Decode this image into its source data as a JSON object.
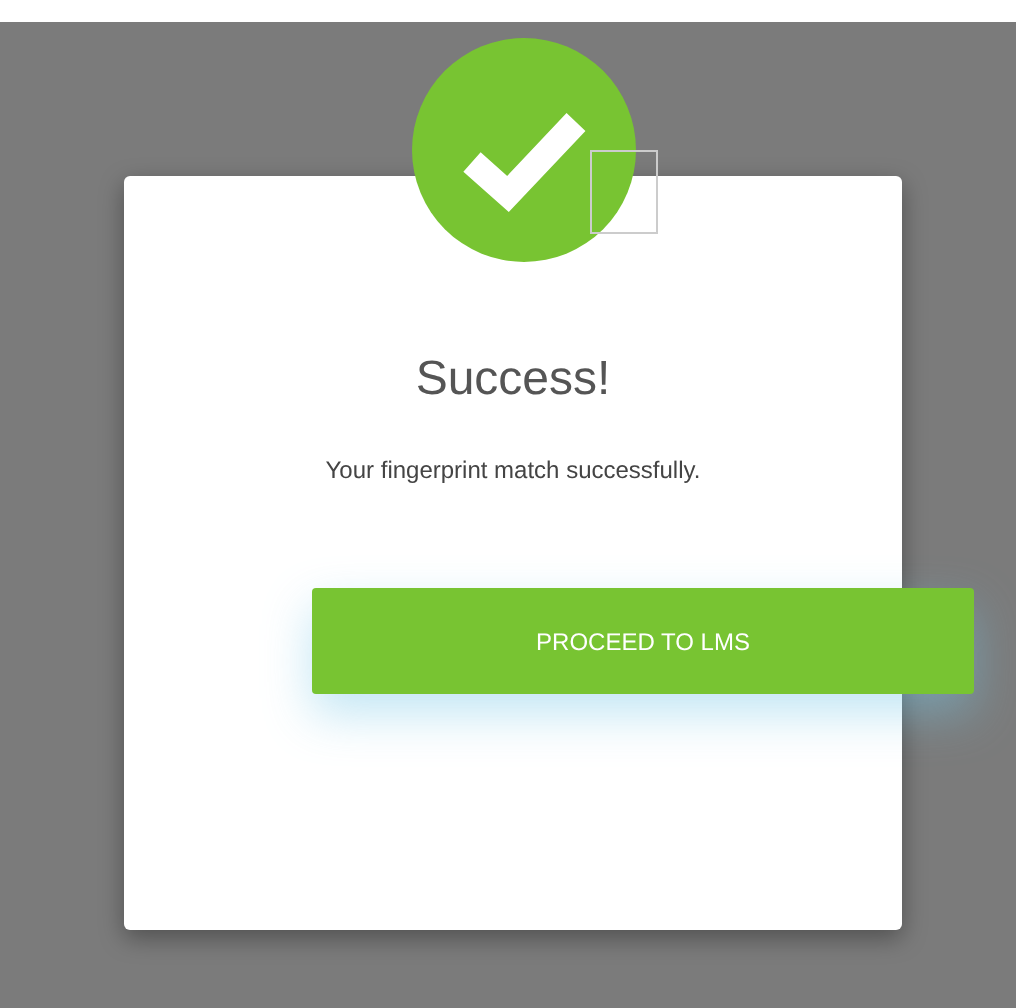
{
  "dialog": {
    "title": "Success!",
    "message": "Your fingerprint match successfully.",
    "button": "PROCEED TO LMS"
  }
}
